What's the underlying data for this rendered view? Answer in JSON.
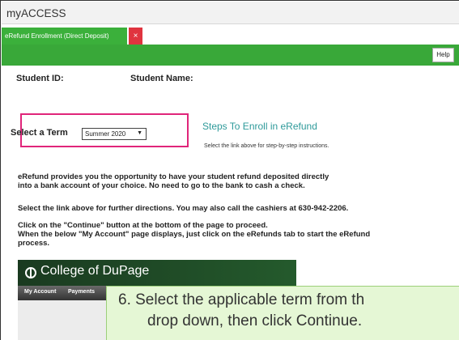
{
  "app": {
    "title": "myACCESS"
  },
  "tabs": [
    {
      "label": "eRefund Enrollment (Direct Deposit)",
      "close_symbol": "×"
    }
  ],
  "toolbar": {
    "help_label": "Help"
  },
  "student": {
    "id_label": "Student ID:",
    "name_label": "Student Name:"
  },
  "term": {
    "label": "Select a Term",
    "selected": "Summer 2020",
    "caret": "▼"
  },
  "steps": {
    "title": "Steps To Enroll in eRefund",
    "subtitle": "Select the link above for step-by-step instructions."
  },
  "paragraphs": {
    "p1_line1": "eRefund provides you the opportunity to have your student refund deposited directly",
    "p1_line2": "into a bank account of your choice. No need to go to the bank to cash a check.",
    "p2": "Select the link above for further directions. You may also call the cashiers at 630-942-2206.",
    "p3_line1": "Click on the \"Continue\" button at the bottom of the page to proceed.",
    "p3_line2": "When the below \"My Account\" page displays, just click on the eRefunds tab to start the eRefund",
    "p3_line3": "process."
  },
  "banner": {
    "college_name": "College of DuPage",
    "nav": [
      "My Account",
      "Payments"
    ]
  },
  "callout": {
    "line1": "6. Select the applicable term from th",
    "line2": "drop down, then click Continue."
  }
}
